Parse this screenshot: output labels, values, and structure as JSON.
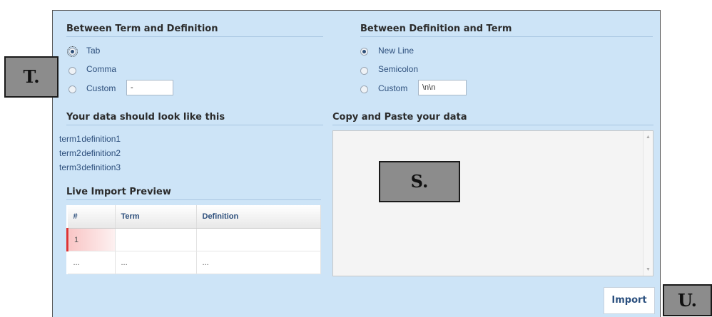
{
  "section_term_def": {
    "title": "Between Term and Definition",
    "options": [
      {
        "label": "Tab",
        "selected": true
      },
      {
        "label": "Comma",
        "selected": false
      },
      {
        "label": "Custom",
        "selected": false
      }
    ],
    "custom_value": "-"
  },
  "section_def_term": {
    "title": "Between Definition and Term",
    "options": [
      {
        "label": "New Line",
        "selected": true
      },
      {
        "label": "Semicolon",
        "selected": false
      },
      {
        "label": "Custom",
        "selected": false
      }
    ],
    "custom_value": "\\n\\n"
  },
  "sample": {
    "title": "Your data should look like this",
    "rows": [
      {
        "term": "term1",
        "definition": "definition1"
      },
      {
        "term": "term2",
        "definition": "definition2"
      },
      {
        "term": "term3",
        "definition": "definition3"
      }
    ]
  },
  "paste": {
    "title": "Copy and Paste your data"
  },
  "preview": {
    "title": "Live Import Preview",
    "columns": [
      "#",
      "Term",
      "Definition"
    ],
    "rows": [
      [
        "1",
        "",
        ""
      ],
      [
        "...",
        "...",
        "..."
      ]
    ]
  },
  "import_button": "Import",
  "callouts": {
    "t": "T.",
    "s": "S.",
    "u": "U."
  },
  "colors": {
    "panel_bg": "#cde4f7",
    "accent_text": "#2d4f7c",
    "highlight_row": "#f9c6c6"
  }
}
